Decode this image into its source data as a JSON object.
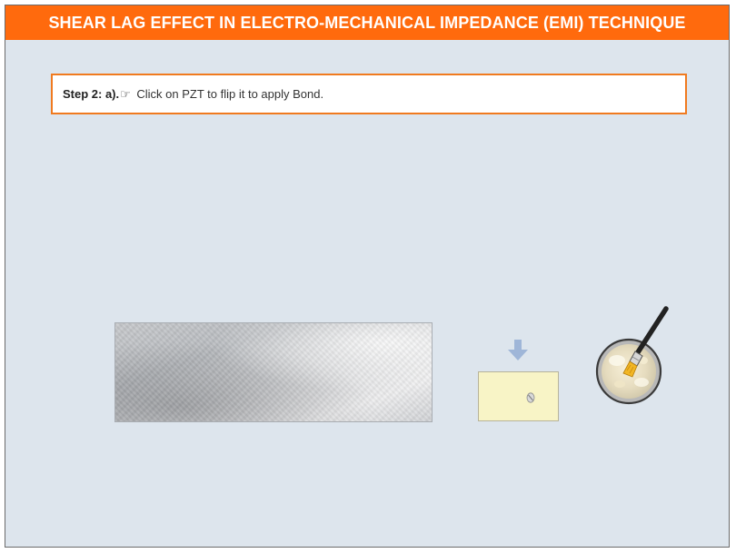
{
  "header": {
    "title": "SHEAR LAG EFFECT IN ELECTRO-MECHANICAL IMPEDANCE (EMI) TECHNIQUE"
  },
  "instruction": {
    "step_label": "Step 2: a).",
    "hand_icon": "pointing-hand-icon",
    "text": " Click on PZT to flip it to apply Bond."
  },
  "colors": {
    "header_bg": "#ff6a0d",
    "stage_bg": "#dde5ed",
    "instruction_border": "#f07a1f",
    "pzt_fill": "#f8f4c6",
    "arrow": "#9fb6d8"
  },
  "icons": {
    "arrow": "down-arrow-icon",
    "bowl": "adhesive-bowl-with-brush-icon"
  }
}
